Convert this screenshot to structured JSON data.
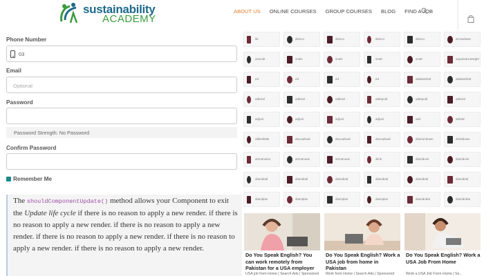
{
  "header": {
    "logo_line1": "sustainability",
    "logo_line2": "ACADEMY",
    "nav": [
      "ABOUT US",
      "ONLINE COURSES",
      "GROUP COURSES",
      "BLOG",
      "FIND A JOB"
    ],
    "accent": "#e27a2a"
  },
  "form": {
    "phone_label": "Phone Number",
    "phone_value": "03",
    "email_label": "Email",
    "email_placeholder": "Optional",
    "password_label": "Password",
    "strength_text": "Password Strength: No Password",
    "confirm_label": "Confirm Password",
    "remember_label": "Remember Me"
  },
  "article": {
    "t1": "The ",
    "code": "shouldComponentUpdate()",
    "t2": " method allows your Component to exit the ",
    "em": "Update life cycle",
    "t3": " if there is no reason to apply a new render. if there is no reason to apply a new render. if there is no reason to apply a new render. if there is no reason to apply a new render. if there is no reason to apply a new render. if there is no reason to apply a new render."
  },
  "icon_grid": [
    [
      "lib",
      "diesco",
      "diesco",
      "diesco",
      "diesco",
      "arrowdown"
    ],
    [
      "anscalt",
      "snels",
      "snels",
      "snett",
      "snett",
      "squarearrowright"
    ],
    [
      "ed",
      "ed",
      "ed",
      "ed",
      "adalearbolt",
      "adalearbolt"
    ],
    [
      "adteral",
      "adteral",
      "adteral",
      "adtepoid",
      "adtepoid",
      "adteral"
    ],
    [
      "adjust",
      "adjust",
      "adjust",
      "adjust",
      "adri",
      "adreal"
    ],
    [
      "ddleshtitle",
      "devoutlook",
      "devoutlook",
      "devoutlook",
      "diamondown",
      "drinkdown"
    ],
    [
      "airmenutov",
      "airmenuse",
      "airmenuse",
      "slink",
      "diamdock",
      "diamdock"
    ],
    [
      "diamdeal",
      "diamdeal",
      "diamdeal",
      "diamdeal",
      "diamdeal",
      "diamdeal"
    ],
    [
      "diamplas",
      "diamplas",
      "diamplas",
      "diamplas",
      "diamdrabe",
      "diamdrabe"
    ]
  ],
  "ads": [
    {
      "title": "Do You Speak English? You can work remotely from Pakistan for a USA employer",
      "source": "USA job from Home | Search Ads | Sponsored"
    },
    {
      "title": "Do You Speak English? Work a USA job from home in Pakistan",
      "source": "Work from Home | Search Ads | Sponsored"
    },
    {
      "title": "Do You Speak English? Work a USA Job From Home",
      "source": "Work a USA Job From Home | Se..."
    }
  ]
}
